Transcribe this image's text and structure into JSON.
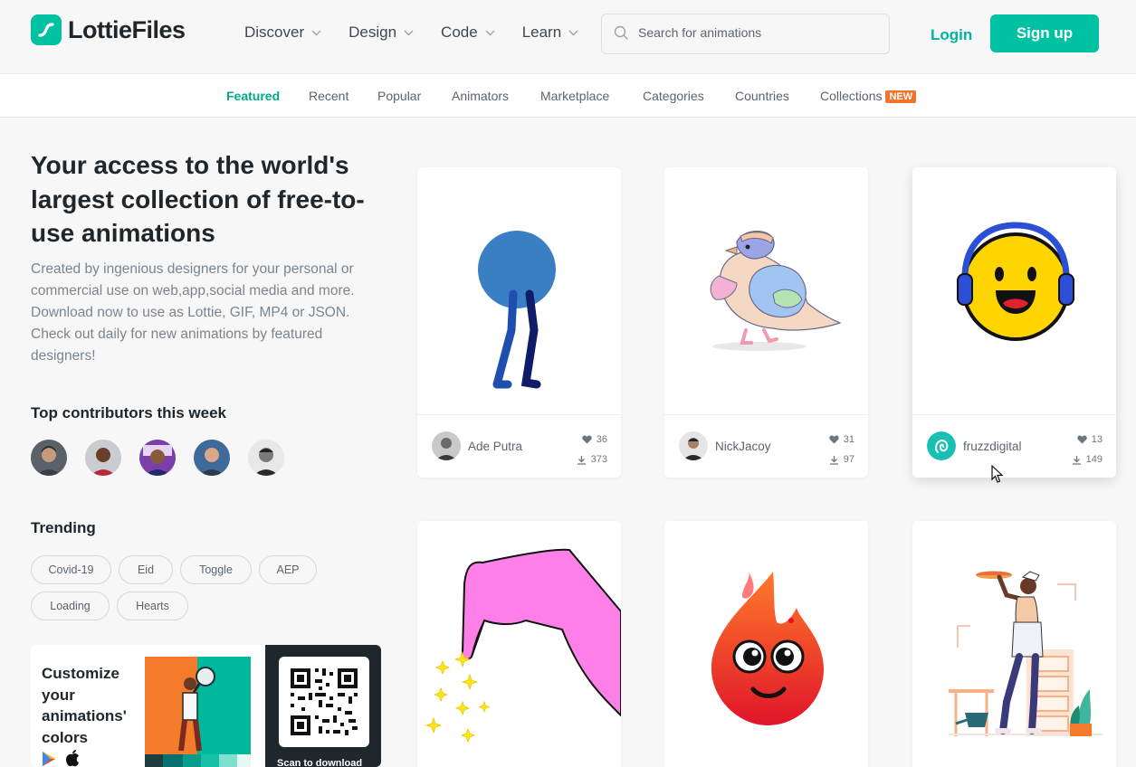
{
  "brand": {
    "name": "LottieFiles",
    "accent": "#00c1a2"
  },
  "nav": [
    {
      "label": "Discover"
    },
    {
      "label": "Design"
    },
    {
      "label": "Code"
    },
    {
      "label": "Learn"
    }
  ],
  "search": {
    "placeholder": "Search for animations"
  },
  "auth": {
    "login": "Login",
    "signup": "Sign up"
  },
  "subnav": {
    "items": [
      "Featured",
      "Recent",
      "Popular",
      "Animators",
      "Marketplace",
      "Categories",
      "Countries",
      "Collections"
    ],
    "active": "Featured",
    "new_badge": "NEW"
  },
  "hero": {
    "title": "Your access to the world's largest collection of free-to-use animations",
    "description": "Created by ingenious designers for your personal or commercial use on web,app,social media and more. Download now to use as Lottie, GIF, MP4 or JSON. Check out daily for new animations by featured designers!"
  },
  "contributors": {
    "title": "Top contributors this week"
  },
  "trending": {
    "title": "Trending",
    "tags": [
      "Covid-19",
      "Eid",
      "Toggle",
      "AEP",
      "Loading",
      "Hearts"
    ]
  },
  "promo": {
    "text": "Customize your animations' colors",
    "scan": "Scan to download"
  },
  "cards": [
    {
      "author": "Ade Putra",
      "likes": "36",
      "downloads": "373"
    },
    {
      "author": "NickJacoy",
      "likes": "31",
      "downloads": "97"
    },
    {
      "author": "fruzzdigital",
      "likes": "13",
      "downloads": "149"
    }
  ]
}
